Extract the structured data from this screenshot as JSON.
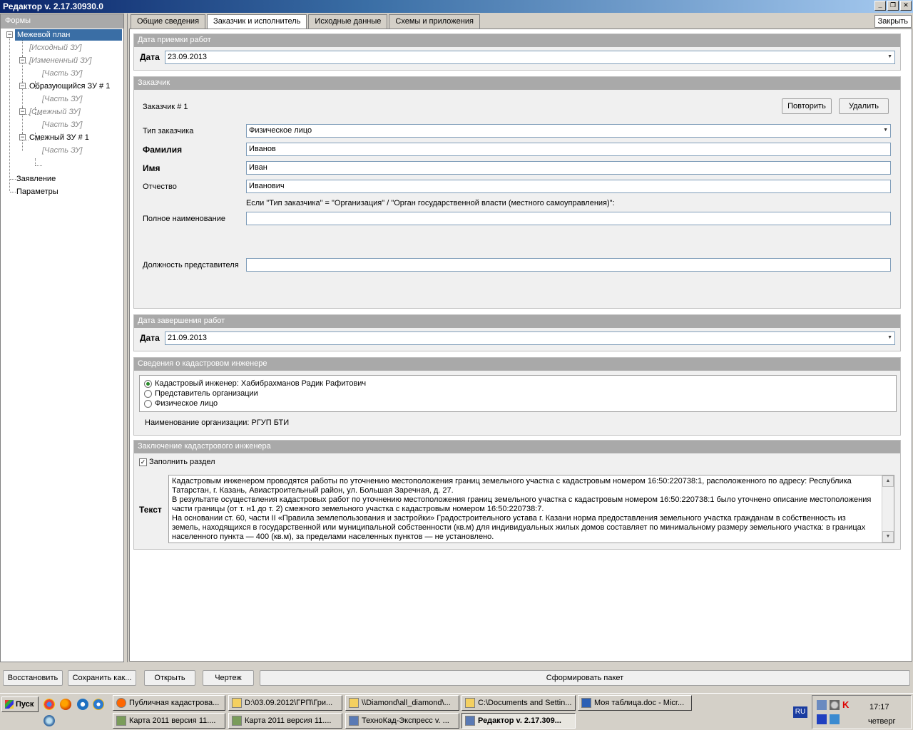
{
  "window": {
    "title": "Редактор v. 2.17.30930.0"
  },
  "left_panel": {
    "header": "Формы",
    "tree": [
      {
        "label": "Межевой план",
        "disabled": false,
        "selected": true
      },
      {
        "label": "[Исходный ЗУ]",
        "disabled": true
      },
      {
        "label": "[Измененный ЗУ]",
        "disabled": true
      },
      {
        "label": "[Часть ЗУ]",
        "disabled": true
      },
      {
        "label": "Образующийся ЗУ # 1",
        "disabled": false
      },
      {
        "label": "[Часть ЗУ]",
        "disabled": true
      },
      {
        "label": "[Смежный ЗУ]",
        "disabled": true
      },
      {
        "label": "[Часть ЗУ]",
        "disabled": true
      },
      {
        "label": "Смежный ЗУ # 1",
        "disabled": false
      },
      {
        "label": "[Часть ЗУ]",
        "disabled": true
      },
      {
        "label": "Заявление",
        "disabled": false
      },
      {
        "label": "Параметры",
        "disabled": false
      }
    ]
  },
  "tabs": [
    {
      "label": "Общие сведения"
    },
    {
      "label": "Заказчик и исполнитель",
      "active": true
    },
    {
      "label": "Исходные данные"
    },
    {
      "label": "Схемы и приложения"
    }
  ],
  "close_label": "Закрыть",
  "acceptance": {
    "header": "Дата приемки работ",
    "date_label": "Дата",
    "date_value": "23.09.2013"
  },
  "customer": {
    "header": "Заказчик",
    "title": "Заказчик # 1",
    "repeat_label": "Повторить",
    "delete_label": "Удалить",
    "type_label": "Тип заказчика",
    "type_value": "Физическое лицо",
    "surname_label": "Фамилия",
    "surname_value": "Иванов",
    "name_label": "Имя",
    "name_value": "Иван",
    "patronymic_label": "Отчество",
    "patronymic_value": "Иванович",
    "org_note": "Если \"Тип заказчика\" = \"Организация\" / \"Орган государственной власти (местного самоуправления)\":",
    "fullname_label": "Полное наименование",
    "fullname_value": "",
    "position_label": "Должность представителя",
    "position_value": ""
  },
  "completion": {
    "header": "Дата завершения работ",
    "date_label": "Дата",
    "date_value": "21.09.2013"
  },
  "engineer": {
    "header": "Сведения о кадастровом инженере",
    "options": [
      {
        "label": "Кадастровый инженер: Хабибрахманов Радик Рафитович",
        "selected": true
      },
      {
        "label": "Представитель организации",
        "selected": false
      },
      {
        "label": "Физическое лицо",
        "selected": false
      }
    ],
    "org_name": "Наименование организации: РГУП БТИ"
  },
  "conclusion": {
    "header": "Заключение кадастрового инженера",
    "fill_label": "Заполнить раздел",
    "fill_checked": true,
    "text_label": "Текст",
    "text_lines": [
      "Кадастровым инженером проводятся работы по уточнению местоположения границ земельного участка с кадастровым номером 16:50:220738:1,  расположенного по адресу: Республика",
      "Татарстан, г. Казань, Авиастроительный район, ул.  Большая Заречная, д.  27.",
      "В результате осуществления кадастровых работ по уточнению местоположения границ земельного участка с кадастровым номером 16:50:220738:1 было уточнено описание местоположения",
      "части границы (от т. н1 до т. 2) смежного земельного участка с кадастровым номером 16:50:220738:7.",
      "На основании  ст. 60, части II «Правила землепользования и застройки» Градостроительного устава г. Казани норма предоставления земельного участка гражданам в собственность из",
      "земель, находящихся в государственной или муниципальной собственности (кв.м) для индивидуальных жилых домов составляет по минимальному размеру земельного участка: в границах",
      "населенного пункта — 400 (кв.м), за пределами населенных пунктов — не установлено."
    ]
  },
  "bottom_buttons": {
    "restore": "Восстановить",
    "save_as": "Сохранить как...",
    "open": "Открыть",
    "drawing": "Чертеж",
    "form_package": "Сформировать пакет"
  },
  "taskbar": {
    "start": "Пуск",
    "tasks_row1": [
      "Публичная кадастрова...",
      "D:\\03.09.2012\\ГРП\\Гри...",
      "\\\\Diamond\\all_diamond\\...",
      "C:\\Documents and Settin...",
      "Моя таблица.doc - Micr..."
    ],
    "tasks_row2": [
      "Карта 2011 версия 11....",
      "Карта 2011 версия 11....",
      "ТехноКад-Экспресс v. ...",
      "Редактор v. 2.17.309..."
    ],
    "lang": "RU",
    "time": "17:17",
    "day": "четверг"
  }
}
